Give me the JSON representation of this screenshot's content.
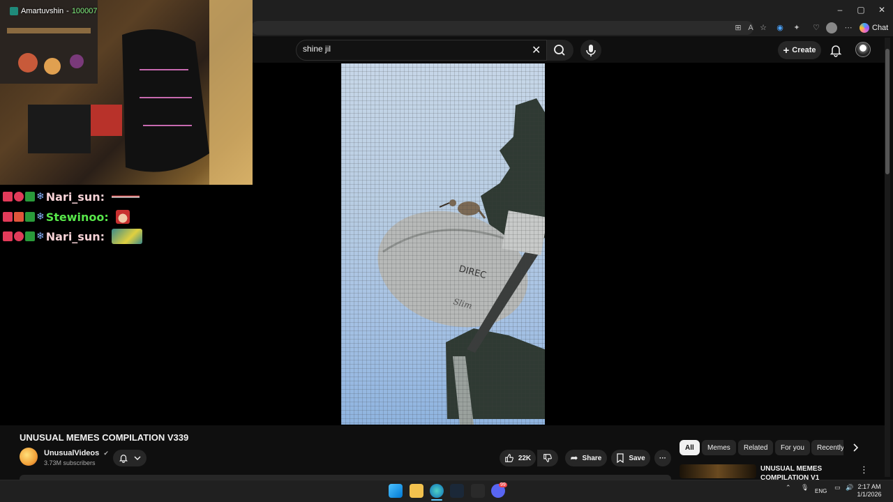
{
  "stream": {
    "streamer": "Amartuvshin",
    "separator": " - ",
    "count": "100007"
  },
  "chat": [
    {
      "user": "Nari_sun:",
      "color": "#f7d2d6"
    },
    {
      "user": "Stewinoo:",
      "color": "#57e64a"
    },
    {
      "user": "Nari_sun:",
      "color": "#f7d2d6"
    }
  ],
  "browser": {
    "chat_label": "Chat",
    "window_controls": [
      "–",
      "▢",
      "✕"
    ]
  },
  "youtube": {
    "search_value": "shine jil",
    "create_label": "Create",
    "video_title": "UNUSUAL MEMES COMPILATION V339",
    "channel_name": "UnusualVideos",
    "verified": "✔",
    "subscribers": "3.73M subscribers",
    "likes": "22K",
    "share_label": "Share",
    "save_label": "Save",
    "more": "···",
    "chips": [
      "All",
      "Memes",
      "Related",
      "For you",
      "Recently"
    ],
    "recommended_title": "UNUSUAL MEMES COMPILATION V1"
  },
  "taskbar": {
    "language": "ENG",
    "time": "2:17 AM",
    "date": "1/1/2026",
    "discord_badge": "99"
  },
  "colors": {
    "background": "#0f0f0f",
    "accent_chip_active": "#f1f1f1",
    "stream_count": "#7ef07e"
  }
}
